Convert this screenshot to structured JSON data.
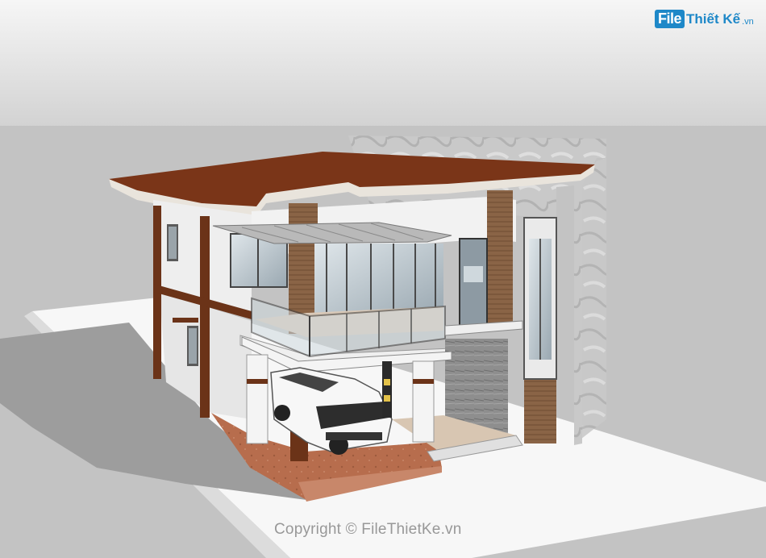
{
  "logo": {
    "file": "File",
    "rest": "Thiết Kế",
    "tld": ".vn"
  },
  "watermark": "Copyright © FileThietKe.vn",
  "colors": {
    "sky_top": "#f4f4f4",
    "sky_bottom": "#cfcfcf",
    "ground": "#c4c4c4",
    "lot": "#f7f7f7",
    "roof": "#7a3518",
    "roof_fascia": "#e8e4dc",
    "wall": "#eeeeee",
    "wood": "#7e5a3e",
    "column_brown": "#6b3318",
    "paving": "#b86e4e",
    "glass": "#c8d4dc",
    "logo_blue": "#1e88c8"
  },
  "icons": [
    "logo-mark"
  ]
}
